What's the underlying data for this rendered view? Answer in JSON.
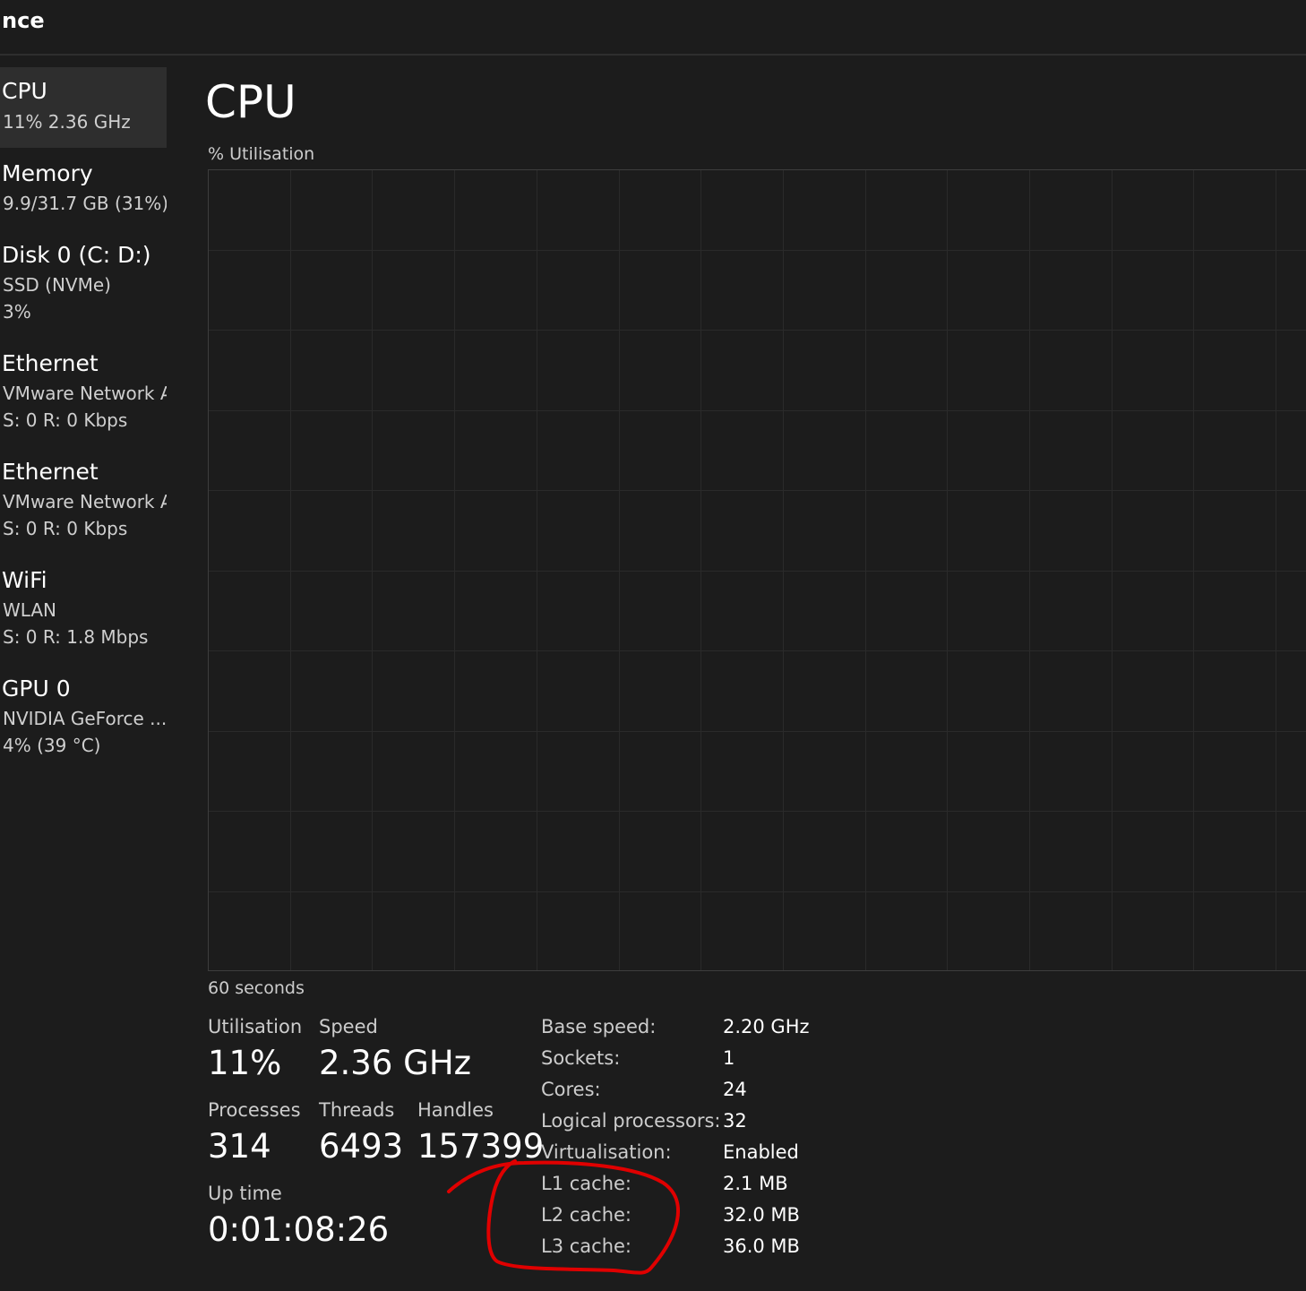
{
  "window": {
    "title": "nce"
  },
  "sidebar": {
    "items": [
      {
        "name": "CPU",
        "line1": "11% 2.36 GHz",
        "line2": "",
        "active": true
      },
      {
        "name": "Memory",
        "line1": "9.9/31.7 GB (31%)",
        "line2": "",
        "active": false
      },
      {
        "name": "Disk 0 (C: D:)",
        "line1": "SSD (NVMe)",
        "line2": "3%",
        "active": false
      },
      {
        "name": "Ethernet",
        "line1": "VMware Network A",
        "line2": "S: 0 R: 0 Kbps",
        "active": false
      },
      {
        "name": "Ethernet",
        "line1": "VMware Network A",
        "line2": "S: 0 R: 0 Kbps",
        "active": false
      },
      {
        "name": "WiFi",
        "line1": "WLAN",
        "line2": "S: 0 R: 1.8 Mbps",
        "active": false
      },
      {
        "name": "GPU 0",
        "line1": "NVIDIA GeForce ...",
        "line2": "4% (39 °C)",
        "active": false
      }
    ]
  },
  "main": {
    "title": "CPU",
    "graph_label": "% Utilisation",
    "graph_time_label": "60 seconds",
    "stats": {
      "utilisation_label": "Utilisation",
      "utilisation_value": "11%",
      "speed_label": "Speed",
      "speed_value": "2.36 GHz",
      "processes_label": "Processes",
      "processes_value": "314",
      "threads_label": "Threads",
      "threads_value": "6493",
      "handles_label": "Handles",
      "handles_value": "157399",
      "uptime_label": "Up time",
      "uptime_value": "0:01:08:26"
    },
    "specs": [
      {
        "label": "Base speed:",
        "value": "2.20 GHz"
      },
      {
        "label": "Sockets:",
        "value": "1"
      },
      {
        "label": "Cores:",
        "value": "24"
      },
      {
        "label": "Logical processors:",
        "value": "32"
      },
      {
        "label": "Virtualisation:",
        "value": "Enabled"
      },
      {
        "label": "L1 cache:",
        "value": "2.1 MB"
      },
      {
        "label": "L2 cache:",
        "value": "32.0 MB"
      },
      {
        "label": "L3 cache:",
        "value": "36.0 MB"
      }
    ]
  },
  "colors": {
    "background": "#1c1c1c",
    "selected_item": "#2e2e2e",
    "graph_grid": "#2a2a2a",
    "graph_border": "#3d3d3d",
    "annotation": "#e00000"
  }
}
